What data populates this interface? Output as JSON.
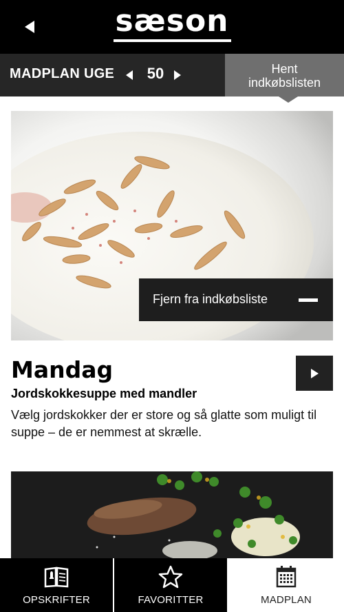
{
  "header": {
    "logo": "sæson",
    "back_icon": "back-arrow-icon"
  },
  "weekbar": {
    "label": "MADPLAN UGE",
    "week": "50",
    "shopping_button_line1": "Hent",
    "shopping_button_line2": "indkøbslisten"
  },
  "recipes": [
    {
      "remove_label": "Fjern fra indkøbsliste",
      "day": "Mandag",
      "title": "Jordskokkesuppe med mandler",
      "description": "Vælg jordskokker der er store og så glatte som muligt til suppe – de er nemmest at skrælle."
    }
  ],
  "tabs": [
    {
      "label": "OPSKRIFTER",
      "icon": "recipe-book-icon"
    },
    {
      "label": "FAVORITTER",
      "icon": "star-icon"
    },
    {
      "label": "MADPLAN",
      "icon": "calendar-icon"
    }
  ],
  "colors": {
    "header_bg": "#000000",
    "weekbar_bg": "#262626",
    "shop_button_bg": "#6f6f6f",
    "active_tab_bg": "#ffffff"
  }
}
